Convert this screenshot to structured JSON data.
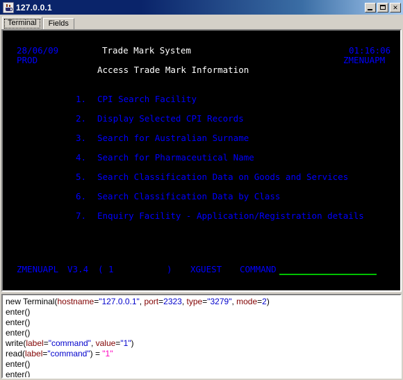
{
  "window": {
    "title": "127.0.0.1",
    "icon": "java-coffee-cup-icon",
    "minimize_label": "Minimize",
    "maximize_label": "Maximize",
    "close_label": "✕"
  },
  "tabs": [
    {
      "label": "Terminal",
      "active": true
    },
    {
      "label": "Fields",
      "active": false
    }
  ],
  "terminal": {
    "background": "#000000",
    "blue": "#0000ff",
    "white": "#ffffff",
    "field_color": "#00c000",
    "header": {
      "date": "28/06/09",
      "environment": "PROD",
      "time": "01:16:06",
      "program": "ZMENUAPM",
      "title": "Trade Mark System",
      "subtitle": "Access Trade Mark Information"
    },
    "menu_items": [
      {
        "number": "1.",
        "label": "CPI Search Facility"
      },
      {
        "number": "2.",
        "label": "Display Selected CPI Records"
      },
      {
        "number": "3.",
        "label": "Search for Australian Surname"
      },
      {
        "number": "4.",
        "label": "Search for Pharmaceutical Name"
      },
      {
        "number": "5.",
        "label": "Search Classification Data on Goods and Services"
      },
      {
        "number": "6.",
        "label": "Search Classification Data by Class"
      },
      {
        "number": "7.",
        "label": "Enquiry Facility - Application/Registration details"
      }
    ],
    "status": {
      "program": "ZMENUAPL",
      "version": "V3.4",
      "paren_open": "(",
      "page": "1",
      "paren_close": ")",
      "user": "XGUEST",
      "command_label": "COMMAND",
      "command_value": ""
    }
  },
  "log": {
    "lines": [
      {
        "tokens": [
          {
            "text": "new Terminal(",
            "type": "fn"
          },
          {
            "text": "hostname",
            "type": "param"
          },
          {
            "text": "=",
            "type": "punc"
          },
          {
            "text": "\"127.0.0.1\"",
            "type": "val"
          },
          {
            "text": ", ",
            "type": "punc"
          },
          {
            "text": "port",
            "type": "param"
          },
          {
            "text": "=",
            "type": "punc"
          },
          {
            "text": "2323",
            "type": "val"
          },
          {
            "text": ", ",
            "type": "punc"
          },
          {
            "text": "type",
            "type": "param"
          },
          {
            "text": "=",
            "type": "punc"
          },
          {
            "text": "\"3279\"",
            "type": "val"
          },
          {
            "text": ", ",
            "type": "punc"
          },
          {
            "text": "mode",
            "type": "param"
          },
          {
            "text": "=",
            "type": "punc"
          },
          {
            "text": "2",
            "type": "val"
          },
          {
            "text": ")",
            "type": "punc"
          }
        ]
      },
      {
        "tokens": [
          {
            "text": "enter()",
            "type": "fn"
          }
        ]
      },
      {
        "tokens": [
          {
            "text": "enter()",
            "type": "fn"
          }
        ]
      },
      {
        "tokens": [
          {
            "text": "enter()",
            "type": "fn"
          }
        ]
      },
      {
        "tokens": [
          {
            "text": "write(",
            "type": "fn"
          },
          {
            "text": "label",
            "type": "param"
          },
          {
            "text": "=",
            "type": "punc"
          },
          {
            "text": "\"command\"",
            "type": "val"
          },
          {
            "text": ", ",
            "type": "punc"
          },
          {
            "text": "value",
            "type": "param"
          },
          {
            "text": "=",
            "type": "punc"
          },
          {
            "text": "\"1\"",
            "type": "val"
          },
          {
            "text": ")",
            "type": "punc"
          }
        ]
      },
      {
        "tokens": [
          {
            "text": "read(",
            "type": "fn"
          },
          {
            "text": "label",
            "type": "param"
          },
          {
            "text": "=",
            "type": "punc"
          },
          {
            "text": "\"command\"",
            "type": "val"
          },
          {
            "text": ") = ",
            "type": "punc"
          },
          {
            "text": "\"1\"",
            "type": "res"
          }
        ]
      },
      {
        "tokens": [
          {
            "text": "enter()",
            "type": "fn"
          }
        ]
      },
      {
        "tokens": [
          {
            "text": "enter()",
            "type": "fn"
          }
        ]
      }
    ]
  }
}
